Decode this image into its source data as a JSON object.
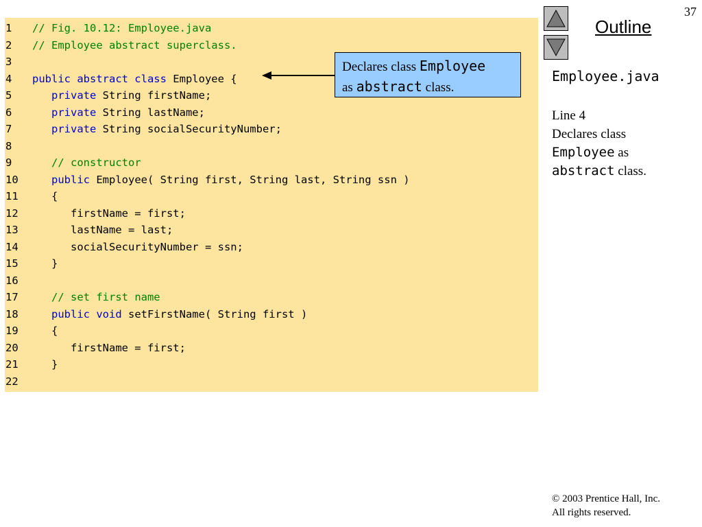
{
  "page_number": "37",
  "outline": {
    "title": "Outline",
    "nav_up_icon": "triangle-up-icon",
    "nav_down_icon": "triangle-down-icon"
  },
  "code": {
    "lines": [
      {
        "num": "1",
        "parts": [
          {
            "t": "// Fig. 10.12: Employee.java",
            "c": "comment"
          }
        ]
      },
      {
        "num": "2",
        "parts": [
          {
            "t": "// Employee abstract superclass.",
            "c": "comment"
          }
        ]
      },
      {
        "num": "3",
        "parts": []
      },
      {
        "num": "4",
        "parts": [
          {
            "t": "public abstract class",
            "c": "keyword"
          },
          {
            "t": " Employee {",
            "c": "plain"
          }
        ]
      },
      {
        "num": "5",
        "parts": [
          {
            "t": "   ",
            "c": "plain"
          },
          {
            "t": "private",
            "c": "keyword"
          },
          {
            "t": " String firstName;",
            "c": "plain"
          }
        ]
      },
      {
        "num": "6",
        "parts": [
          {
            "t": "   ",
            "c": "plain"
          },
          {
            "t": "private",
            "c": "keyword"
          },
          {
            "t": " String lastName;",
            "c": "plain"
          }
        ]
      },
      {
        "num": "7",
        "parts": [
          {
            "t": "   ",
            "c": "plain"
          },
          {
            "t": "private",
            "c": "keyword"
          },
          {
            "t": " String socialSecurityNumber;",
            "c": "plain"
          }
        ]
      },
      {
        "num": "8",
        "parts": []
      },
      {
        "num": "9",
        "parts": [
          {
            "t": "   ",
            "c": "plain"
          },
          {
            "t": "// constructor",
            "c": "comment"
          }
        ]
      },
      {
        "num": "10",
        "parts": [
          {
            "t": "   ",
            "c": "plain"
          },
          {
            "t": "public",
            "c": "keyword"
          },
          {
            "t": " Employee( String first, String last, String ssn )",
            "c": "plain"
          }
        ]
      },
      {
        "num": "11",
        "parts": [
          {
            "t": "   {",
            "c": "plain"
          }
        ]
      },
      {
        "num": "12",
        "parts": [
          {
            "t": "      firstName = first;",
            "c": "plain"
          }
        ]
      },
      {
        "num": "13",
        "parts": [
          {
            "t": "      lastName = last;",
            "c": "plain"
          }
        ]
      },
      {
        "num": "14",
        "parts": [
          {
            "t": "      socialSecurityNumber = ssn;",
            "c": "plain"
          }
        ]
      },
      {
        "num": "15",
        "parts": [
          {
            "t": "   }",
            "c": "plain"
          }
        ]
      },
      {
        "num": "16",
        "parts": []
      },
      {
        "num": "17",
        "parts": [
          {
            "t": "   ",
            "c": "plain"
          },
          {
            "t": "// set first name",
            "c": "comment"
          }
        ]
      },
      {
        "num": "18",
        "parts": [
          {
            "t": "   ",
            "c": "plain"
          },
          {
            "t": "public void",
            "c": "keyword"
          },
          {
            "t": " setFirstName( String first )",
            "c": "plain"
          }
        ]
      },
      {
        "num": "19",
        "parts": [
          {
            "t": "   {",
            "c": "plain"
          }
        ]
      },
      {
        "num": "20",
        "parts": [
          {
            "t": "      firstName = first;",
            "c": "plain"
          }
        ]
      },
      {
        "num": "21",
        "parts": [
          {
            "t": "   }",
            "c": "plain"
          }
        ]
      },
      {
        "num": "22",
        "parts": []
      }
    ]
  },
  "callout": {
    "line1_text": "Declares class ",
    "line1_code": "Employee",
    "line2_text": "as ",
    "line2_code": "abstract",
    "line2_suffix": " class."
  },
  "side_notes": {
    "file": "Employee.java",
    "line_ref": "Line 4",
    "desc_1": "Declares class",
    "desc_code_1": "Employee",
    "desc_2": " as",
    "desc_code_2": "abstract",
    "desc_3": " class."
  },
  "footer": {
    "copyright": "© 2003 Prentice Hall, Inc.",
    "rights": "All rights reserved."
  },
  "colors": {
    "code_background": "#fde59f",
    "keyword": "#0000cc",
    "comment": "#008000",
    "callout_background": "#99ccff"
  }
}
